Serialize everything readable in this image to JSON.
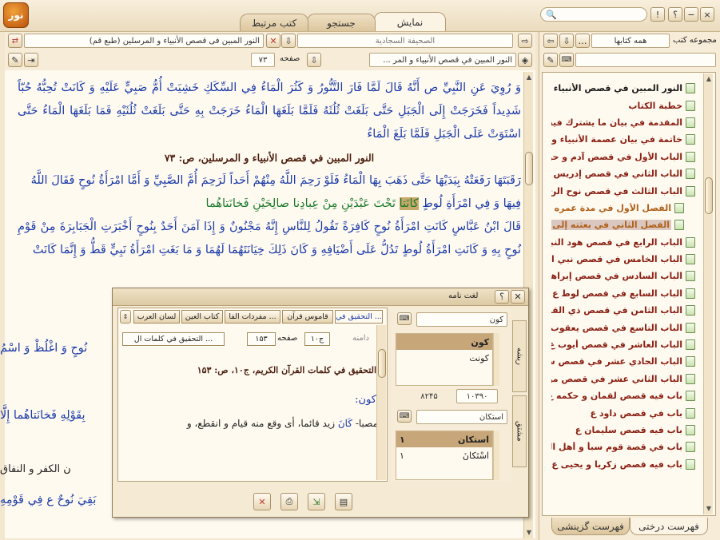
{
  "app": {
    "logo_text": "نور"
  },
  "tabs": [
    {
      "label": "نمایش",
      "active": true
    },
    {
      "label": "جستجو",
      "active": false
    },
    {
      "label": "کتب مرتبط",
      "active": false
    }
  ],
  "window_controls": {
    "close": "×",
    "minimize": "−",
    "help": "؟",
    "info": "!"
  },
  "book_bar": {
    "title_field": "النور المبين فى قصص الأنبياء و المرسلين (طبع قم)",
    "other_book": "الصحيفة السجادية",
    "page_label": "صفحه",
    "page_value": "۷۳",
    "section_select": "النور المبين في قصص الأنبياء و المر ..."
  },
  "reader": {
    "para1": "وَ رُوِيَ عَنِ النَّبِيِّ ص أَنَّهُ قَالَ لَمَّا فَارَ التَّنُّورُ وَ كَثُرَ الْمَاءُ فِي السِّكَكِ خَشِيَتْ أُمُّ صَبِيٍّ عَلَيْهِ وَ كَانَتْ تُحِبُّهُ حُبّاً شَدِيداً فَخَرَجَتْ إِلَى الْجَبَلِ حَتَّى بَلَغَتْ ثُلُثَهُ فَلَمَّا بَلَغَهَا الْمَاءُ خَرَجَتْ بِهِ حَتَّى بَلَغَتْ ثُلُثَيْهِ فَمَا بَلَغَهَا الْمَاءُ حَتَّى اسْتَوَتْ عَلَى الْجَبَلِ فَلَمَّا بَلَغَ الْمَاءُ",
    "page_heading": "النور المبين في قصص الأنبياء و المرسلين، ص: ۷۳",
    "para2": "رَقَبَتَهَا رَفَعَتْهُ بِيَدَيْهَا حَتَّى ذَهَبَ بِهَا الْمَاءُ فَلَوْ رَحِمَ اللَّهُ مِنْهُمْ أَحَداً لَرَحِمَ أُمَّ الصَّبِيِّ وَ أَمَّا امْرَأَةُ نُوحٍ فَقَالَ اللَّهُ",
    "para3a": "فِيهَا وَ فِي امْرَأَةِ لُوطٍ",
    "para3_highlight": "كانَتا",
    "para3b": "تَحْتَ عَبْدَيْنِ مِنْ عِبادِنا صالِحَيْنِ فَخانَتاهُما",
    "para4": "قَالَ ابْنُ عَبَّاسٍ كَانَتِ امْرَأَةُ نُوحٍ كَافِرَةً تَقُولُ لِلنَّاسِ إِنَّهُ مَجْنُونٌ وَ إِذَا آمَنَ أَحَدٌ بِنُوحٍ أَخْبَرَتِ الْجَبَابِرَةَ مِنْ قَوْمِ نُوحٍ بِهِ وَ كَانَتِ امْرَأَةُ لُوطٍ تَدُلُّ عَلَى أَضْيَافِهِ وَ كَانَ ذَلِكَ خِيَانَتَهُمَا لَهُمَا وَ مَا بَغَتِ امْرَأَةُ نَبِيٍّ قَطُّ وَ إِنَّمَا كَانَتْ",
    "frag1": "نُوحٍ وَ اغْلُظْ وَ اسْمُ",
    "frag2": "بِقَوْلِهِ فَخانَتاهُما إِلَّا",
    "frag3": "ن الكفر و النفاق",
    "frag4": "بَقِيَ نُوحٌ ع فِي قَوْمِهِ"
  },
  "right_panel": {
    "label": "مجموعه کتب",
    "selector": "همه کتابها",
    "tree": [
      {
        "label": "النور المبين في قصص الأنبياء و الم",
        "type": "root"
      },
      {
        "label": "خطبة الكتاب",
        "type": "item"
      },
      {
        "label": "المقدمة في بيان ما يشترك فيه",
        "type": "item"
      },
      {
        "label": "خاتمة في بيان عصمة الأنبياء و",
        "type": "item"
      },
      {
        "label": "الباب الأول في قصص آدم و حو",
        "type": "item"
      },
      {
        "label": "الباب الثاني في قصص إدريس",
        "type": "item"
      },
      {
        "label": "الباب الثالث في قصص نوح الن",
        "type": "item"
      },
      {
        "label": "الفصل الأول في مدة عمره و",
        "type": "sub"
      },
      {
        "label": "الفصل الثاني في بعثته إلى",
        "type": "sub",
        "selected": true
      },
      {
        "label": "الباب الرابع في قصص هود النبي",
        "type": "item"
      },
      {
        "label": "الباب الخامس في قصص نبي الله",
        "type": "item"
      },
      {
        "label": "الباب السادس في قصص إبراهيم",
        "type": "item"
      },
      {
        "label": "الباب السابع في قصص لوط ع",
        "type": "item"
      },
      {
        "label": "الباب الثامن في قصص ذي القرن",
        "type": "item"
      },
      {
        "label": "الباب التاسع في قصص يعقوب",
        "type": "item"
      },
      {
        "label": "الباب العاشر في قصص أيوب ع",
        "type": "item"
      },
      {
        "label": "الباب الحادي عشر في قصص ش",
        "type": "item"
      },
      {
        "label": "الباب الثاني عشر في قصص مو",
        "type": "item"
      },
      {
        "label": "باب فيه قصص لقمان و حكمه ع",
        "type": "item"
      },
      {
        "label": "باب في قصص داود ع",
        "type": "item"
      },
      {
        "label": "باب فيه قصص سليمان ع",
        "type": "item"
      },
      {
        "label": "باب في قصة قوم سبأ و أهل الثر",
        "type": "item"
      },
      {
        "label": "باب فيه قصص زكريا و يحيى ع",
        "type": "item"
      }
    ],
    "bottom_tabs": [
      "فهرست درختی",
      "فهرست گزینشی"
    ]
  },
  "dialog": {
    "title": "لغت نامه",
    "dict_tabs": [
      "التحقيق في ...",
      "قاموس قرآن",
      "مفردات الفا ...",
      "كتاب العين",
      "لسان العرب"
    ],
    "source_field": "التحقيق في كلمات ال ...",
    "volume_label": "دامنه",
    "volume_value": "ج۱۰",
    "page_label": "صفحه",
    "page_value": "۱۵۳",
    "heading": "التحقيق في كلمات القرآن الكريم، ج۱۰، ص: ۱۵۳",
    "entry_word": "كون:",
    "body_a": "مصبا-",
    "body_keyword": "كَانَ",
    "body_b": "زيد قائما، أى وقع منه قيام و انقطع، و",
    "search1": "كون",
    "list1": [
      "كون",
      "كونت"
    ],
    "num1": "۱۰۳۹۰",
    "num2": "۸۲۴۵",
    "search2": "استكان",
    "list2": [
      {
        "word": "استكان",
        "n": "۱"
      },
      {
        "word": "اسْتَكانَ",
        "n": "۱"
      }
    ],
    "side_labels": [
      "ريشه",
      "مشتق"
    ]
  }
}
